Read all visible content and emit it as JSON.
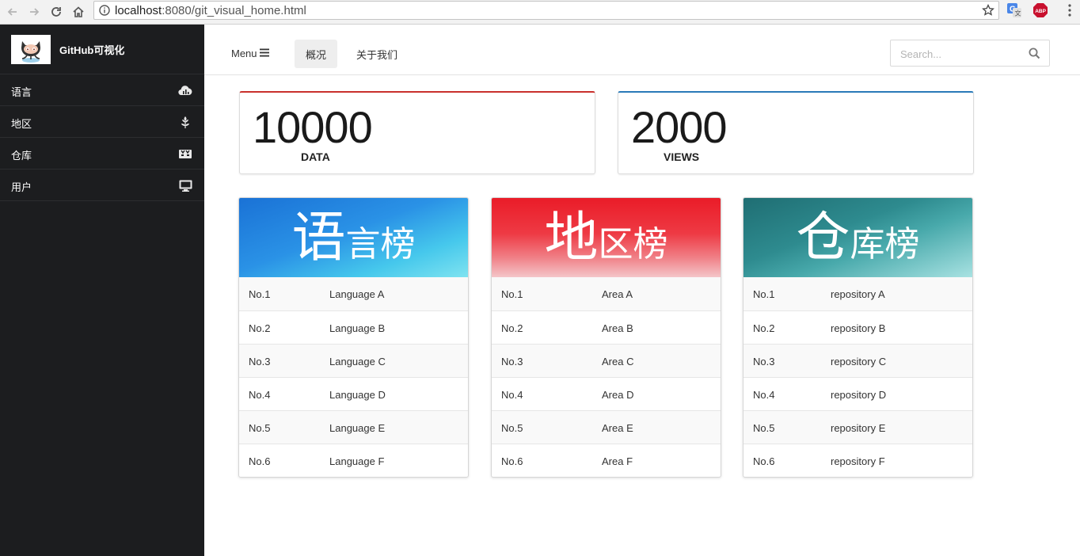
{
  "browser": {
    "url_host": "localhost",
    "url_rest": ":8080/git_visual_home.html",
    "extensions": [
      "translate-icon",
      "abp-icon"
    ],
    "abp_label": "ABP"
  },
  "sidebar": {
    "brand": "GitHub可视化",
    "items": [
      {
        "label": "语言",
        "icon": "cloud-chart-icon"
      },
      {
        "label": "地区",
        "icon": "leaf-icon"
      },
      {
        "label": "仓库",
        "icon": "repo-icon"
      },
      {
        "label": "用户",
        "icon": "monitor-icon"
      }
    ]
  },
  "topnav": {
    "menu_label": "Menu",
    "tabs": [
      {
        "label": "概况",
        "active": true
      },
      {
        "label": "关于我们",
        "active": false
      }
    ],
    "search_placeholder": "Search..."
  },
  "stats": [
    {
      "value": "10000",
      "caption": "DATA",
      "accent": "#c9302c"
    },
    {
      "value": "2000",
      "caption": "VIEWS",
      "accent": "#2a7ab8"
    }
  ],
  "rankings": [
    {
      "title_big": "语",
      "title_small": "言榜",
      "rows": [
        {
          "rank": "No.1",
          "name": "Language A"
        },
        {
          "rank": "No.2",
          "name": "Language B"
        },
        {
          "rank": "No.3",
          "name": "Language C"
        },
        {
          "rank": "No.4",
          "name": "Language D"
        },
        {
          "rank": "No.5",
          "name": "Language E"
        },
        {
          "rank": "No.6",
          "name": "Language F"
        }
      ]
    },
    {
      "title_big": "地",
      "title_small": "区榜",
      "rows": [
        {
          "rank": "No.1",
          "name": "Area A"
        },
        {
          "rank": "No.2",
          "name": "Area B"
        },
        {
          "rank": "No.3",
          "name": "Area C"
        },
        {
          "rank": "No.4",
          "name": "Area D"
        },
        {
          "rank": "No.5",
          "name": "Area E"
        },
        {
          "rank": "No.6",
          "name": "Area F"
        }
      ]
    },
    {
      "title_big": "仓",
      "title_small": "库榜",
      "rows": [
        {
          "rank": "No.1",
          "name": "repository A"
        },
        {
          "rank": "No.2",
          "name": "repository B"
        },
        {
          "rank": "No.3",
          "name": "repository C"
        },
        {
          "rank": "No.4",
          "name": "repository D"
        },
        {
          "rank": "No.5",
          "name": "repository E"
        },
        {
          "rank": "No.6",
          "name": "repository F"
        }
      ]
    }
  ]
}
